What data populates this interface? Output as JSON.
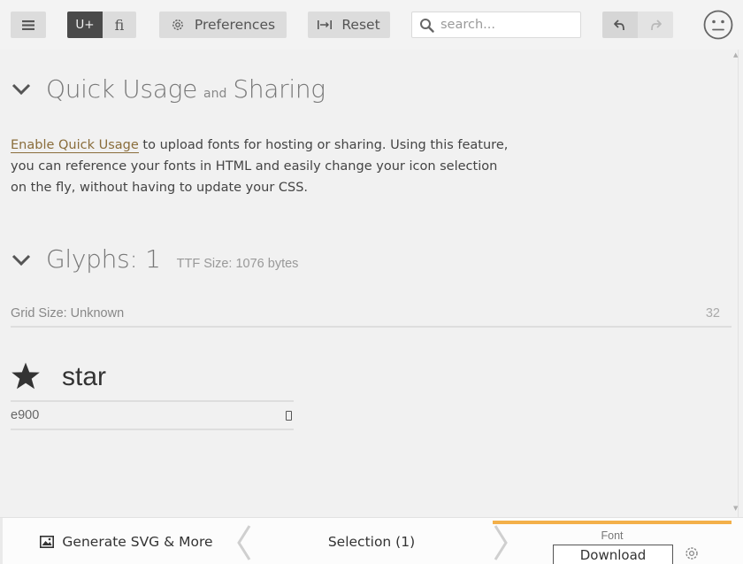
{
  "toolbar": {
    "unicode_label": "U+",
    "ligature_label": "fi",
    "preferences_label": "Preferences",
    "reset_label": "Reset",
    "search_placeholder": "search..."
  },
  "quick_usage": {
    "title_part1": "Quick Usage",
    "title_and": "and",
    "title_part2": "Sharing",
    "link_text": "Enable Quick Usage",
    "desc_line1": " to upload fonts for hosting or sharing. Using this feature,",
    "desc_line2": "you can reference your fonts in HTML and easily change your icon selection",
    "desc_line3": "on the fly, without having to update your CSS."
  },
  "glyphs": {
    "title": "Glyphs: 1",
    "ttf_size": "TTF Size: 1076 bytes",
    "grid_label": "Grid Size: Unknown",
    "grid_value": "32",
    "items": [
      {
        "name": "star",
        "code": "e900",
        "icon": "star-icon"
      }
    ]
  },
  "bottom": {
    "generate_label": "Generate SVG & More",
    "selection_label": "Selection (1)",
    "font_label": "Font",
    "download_label": "Download"
  },
  "colors": {
    "accent": "#f3b04a",
    "link": "#8a6d3b",
    "active_toggle": "#4a4a4a"
  }
}
